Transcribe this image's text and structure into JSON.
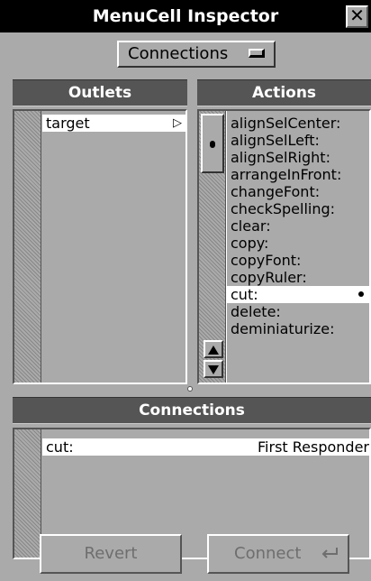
{
  "window": {
    "title": "MenuCell Inspector",
    "close_glyph": "✕"
  },
  "popup": {
    "selected": "Connections"
  },
  "outlets": {
    "header": "Outlets",
    "items": [
      {
        "label": "target",
        "selected": true,
        "arrow": "▷"
      }
    ]
  },
  "actions": {
    "header": "Actions",
    "items": [
      "alignSelCenter:",
      "alignSelLeft:",
      "alignSelRight:",
      "arrangeInFront:",
      "changeFont:",
      "checkSpelling:",
      "clear:",
      "copy:",
      "copyFont:",
      "copyRuler:",
      "cut:",
      "delete:",
      "deminiaturize:"
    ],
    "selected": "cut:",
    "connected_dot": "alignSelLeft:"
  },
  "connections": {
    "header": "Connections",
    "rows": [
      {
        "action": "cut:",
        "target": "First Responder"
      }
    ]
  },
  "buttons": {
    "revert": "Revert",
    "connect": "Connect",
    "connect_icon": "return-icon"
  },
  "colors": {
    "window_bg": "#aaaaaa",
    "header_bg": "#555555",
    "titlebar_bg": "#000000",
    "disabled_text": "#6e6e6e"
  }
}
